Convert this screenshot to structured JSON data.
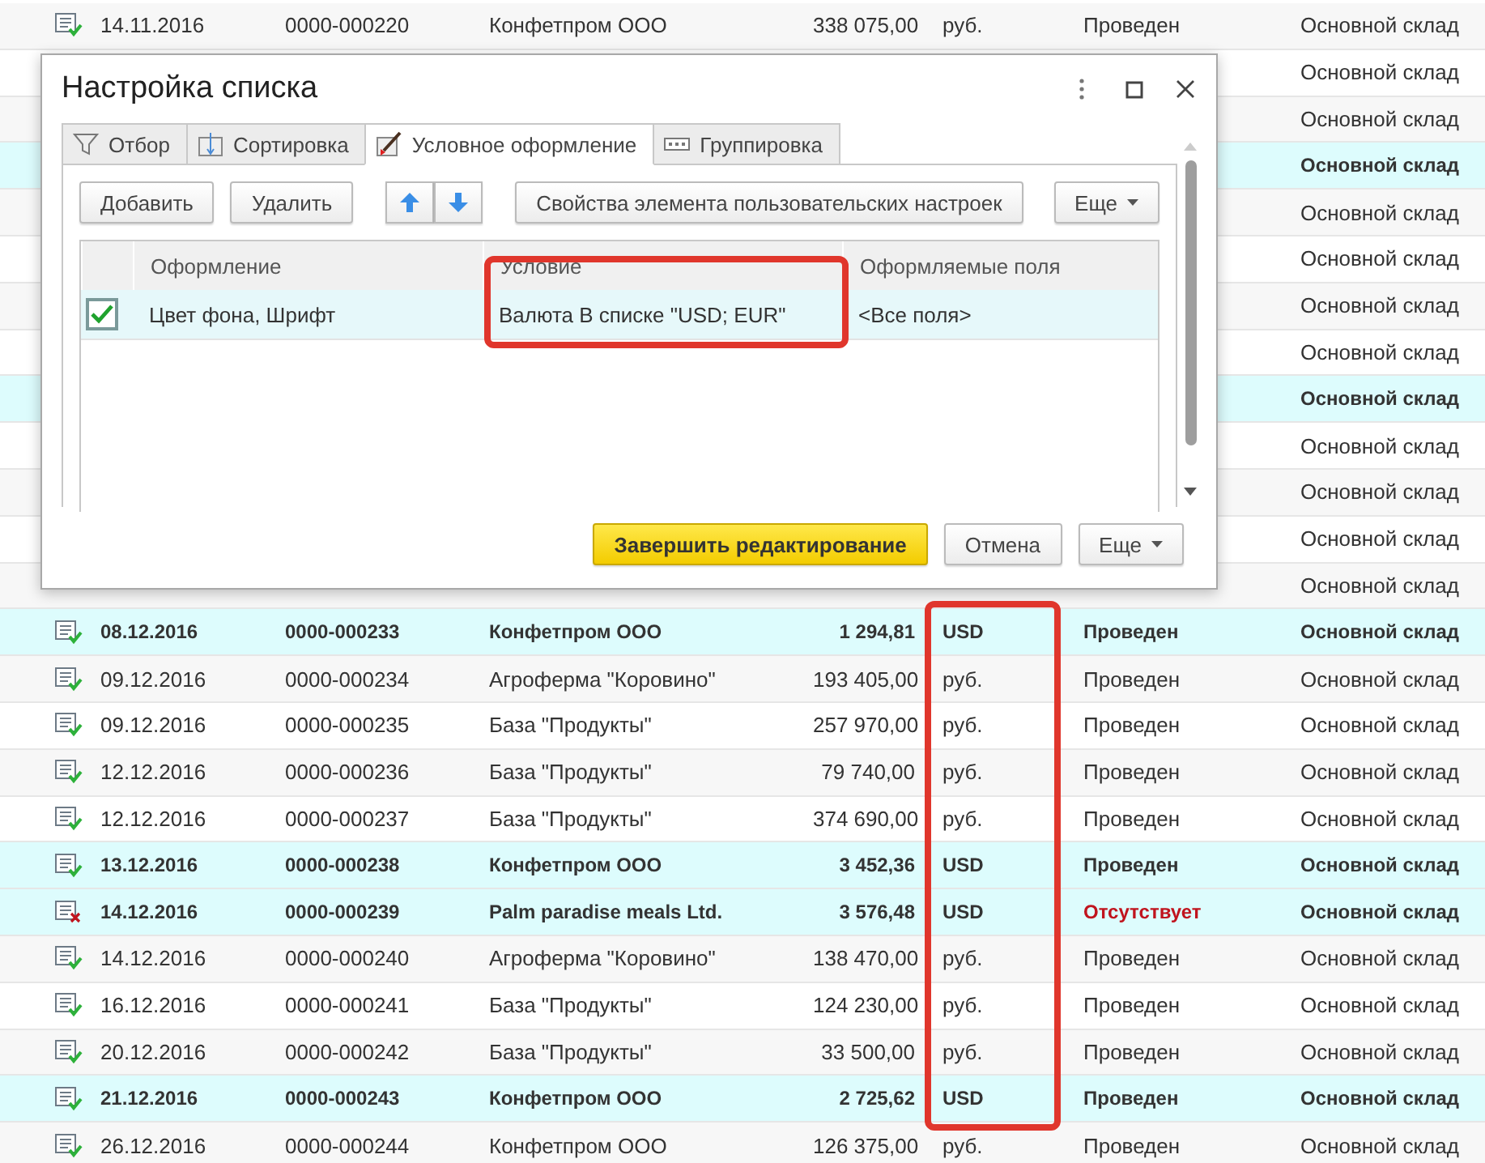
{
  "list": {
    "rows": [
      {
        "date": "14.11.2016",
        "number": "0000-000220",
        "counterparty": "Конфетпром ООО",
        "amount": "338 075,00",
        "currency": "руб.",
        "status": "Проведен",
        "posted": true,
        "warehouse": "Основной склад",
        "highlighted": false
      },
      {
        "warehouse": "Основной склад",
        "highlighted": false
      },
      {
        "warehouse": "Основной склад",
        "highlighted": false
      },
      {
        "warehouse": "Основной склад",
        "highlighted": true
      },
      {
        "warehouse": "Основной склад",
        "highlighted": false
      },
      {
        "warehouse": "Основной склад",
        "highlighted": false
      },
      {
        "warehouse": "Основной склад",
        "highlighted": false
      },
      {
        "warehouse": "Основной склад",
        "highlighted": false
      },
      {
        "warehouse": "Основной склад",
        "highlighted": true
      },
      {
        "warehouse": "Основной склад",
        "highlighted": false
      },
      {
        "warehouse": "Основной склад",
        "highlighted": false
      },
      {
        "warehouse": "Основной склад",
        "highlighted": false
      },
      {
        "warehouse": "Основной склад",
        "highlighted": false
      },
      {
        "date": "08.12.2016",
        "number": "0000-000233",
        "counterparty": "Конфетпром ООО",
        "amount": "1 294,81",
        "currency": "USD",
        "status": "Проведен",
        "posted": true,
        "warehouse": "Основной склад",
        "highlighted": true
      },
      {
        "date": "09.12.2016",
        "number": "0000-000234",
        "counterparty": "Агроферма \"Коровино\"",
        "amount": "193 405,00",
        "currency": "руб.",
        "status": "Проведен",
        "posted": true,
        "warehouse": "Основной склад",
        "highlighted": false
      },
      {
        "date": "09.12.2016",
        "number": "0000-000235",
        "counterparty": "База \"Продукты\"",
        "amount": "257 970,00",
        "currency": "руб.",
        "status": "Проведен",
        "posted": true,
        "warehouse": "Основной склад",
        "highlighted": false
      },
      {
        "date": "12.12.2016",
        "number": "0000-000236",
        "counterparty": "База \"Продукты\"",
        "amount": "79 740,00",
        "currency": "руб.",
        "status": "Проведен",
        "posted": true,
        "warehouse": "Основной склад",
        "highlighted": false
      },
      {
        "date": "12.12.2016",
        "number": "0000-000237",
        "counterparty": "База \"Продукты\"",
        "amount": "374 690,00",
        "currency": "руб.",
        "status": "Проведен",
        "posted": true,
        "warehouse": "Основной склад",
        "highlighted": false
      },
      {
        "date": "13.12.2016",
        "number": "0000-000238",
        "counterparty": "Конфетпром ООО",
        "amount": "3 452,36",
        "currency": "USD",
        "status": "Проведен",
        "posted": true,
        "warehouse": "Основной склад",
        "highlighted": true
      },
      {
        "date": "14.12.2016",
        "number": "0000-000239",
        "counterparty": "Palm paradise meals Ltd.",
        "amount": "3 576,48",
        "currency": "USD",
        "status": "Отсутствует",
        "posted": false,
        "warehouse": "Основной склад",
        "highlighted": true
      },
      {
        "date": "14.12.2016",
        "number": "0000-000240",
        "counterparty": "Агроферма \"Коровино\"",
        "amount": "138 470,00",
        "currency": "руб.",
        "status": "Проведен",
        "posted": true,
        "warehouse": "Основной склад",
        "highlighted": false
      },
      {
        "date": "16.12.2016",
        "number": "0000-000241",
        "counterparty": "База \"Продукты\"",
        "amount": "124 230,00",
        "currency": "руб.",
        "status": "Проведен",
        "posted": true,
        "warehouse": "Основной склад",
        "highlighted": false
      },
      {
        "date": "20.12.2016",
        "number": "0000-000242",
        "counterparty": "База \"Продукты\"",
        "amount": "33 500,00",
        "currency": "руб.",
        "status": "Проведен",
        "posted": true,
        "warehouse": "Основной склад",
        "highlighted": false
      },
      {
        "date": "21.12.2016",
        "number": "0000-000243",
        "counterparty": "Конфетпром ООО",
        "amount": "2 725,62",
        "currency": "USD",
        "status": "Проведен",
        "posted": true,
        "warehouse": "Основной склад",
        "highlighted": true
      },
      {
        "date": "26.12.2016",
        "number": "0000-000244",
        "counterparty": "Конфетпром ООО",
        "amount": "126 375,00",
        "currency": "руб.",
        "status": "Проведен",
        "posted": true,
        "warehouse": "Основной склад",
        "highlighted": false
      }
    ]
  },
  "dialog": {
    "title": "Настройка списка",
    "tabs": [
      {
        "label": "Отбор",
        "selected": false,
        "kind": "filter"
      },
      {
        "label": "Сортировка",
        "selected": false,
        "kind": "sort"
      },
      {
        "label": "Условное оформление",
        "selected": true,
        "kind": "format"
      },
      {
        "label": "Группировка",
        "selected": false,
        "kind": "group"
      }
    ],
    "toolbar": {
      "add": "Добавить",
      "delete": "Удалить",
      "properties": "Свойства элемента пользовательских настроек",
      "more": "Еще"
    },
    "grid": {
      "columns": [
        "Оформление",
        "Условие",
        "Оформляемые поля"
      ],
      "rows": [
        {
          "enabled": true,
          "selected": true,
          "appearance": "Цвет фона, Шрифт",
          "condition": "Валюта В списке \"USD; EUR\"",
          "fields": "<Все поля>"
        }
      ]
    },
    "footer": {
      "finish": "Завершить редактирование",
      "cancel": "Отмена",
      "more": "Еще"
    }
  }
}
